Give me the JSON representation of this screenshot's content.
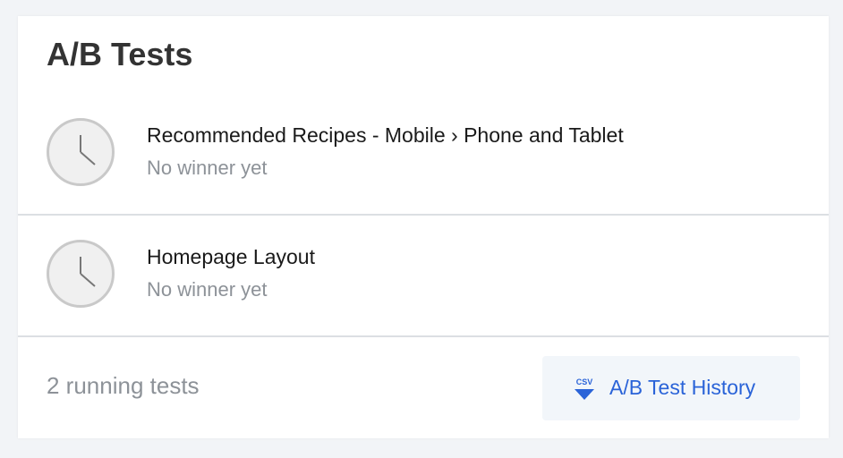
{
  "card": {
    "title": "A/B Tests"
  },
  "tests": [
    {
      "name": "Recommended Recipes - Mobile › Phone and Tablet",
      "status": "No winner yet",
      "icon": "clock-icon"
    },
    {
      "name": "Homepage Layout",
      "status": "No winner yet",
      "icon": "clock-icon"
    }
  ],
  "footer": {
    "count_text": "2 running tests",
    "history_button": {
      "label": "A/B Test History",
      "icon": "csv-download-icon",
      "icon_text": "CSV"
    }
  },
  "colors": {
    "accent": "#2a63d8",
    "muted_text": "#8d9298",
    "divider": "#dcdfe3",
    "clock_fill": "#f0f0f0",
    "clock_border": "#c9c9c9"
  }
}
